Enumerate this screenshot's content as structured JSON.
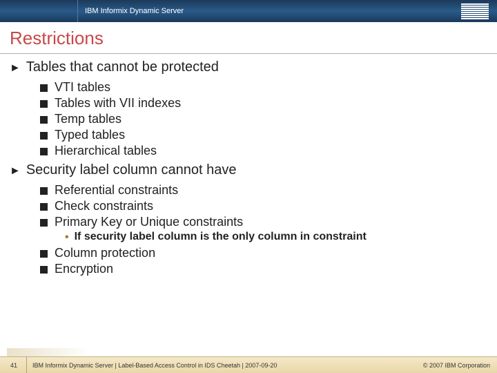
{
  "header": {
    "product": "IBM Informix Dynamic Server"
  },
  "title": "Restrictions",
  "sections": [
    {
      "heading": "Tables that cannot be protected",
      "items": [
        {
          "text": "VTI tables"
        },
        {
          "text": "Tables with VII indexes"
        },
        {
          "text": "Temp tables"
        },
        {
          "text": "Typed tables"
        },
        {
          "text": "Hierarchical tables"
        }
      ]
    },
    {
      "heading": "Security label column cannot have",
      "items": [
        {
          "text": "Referential constraints"
        },
        {
          "text": "Check constraints"
        },
        {
          "text": "Primary Key or Unique constraints",
          "sub": [
            "If security label column is the only column in constraint"
          ]
        },
        {
          "text": "Column protection"
        },
        {
          "text": "Encryption"
        }
      ]
    }
  ],
  "footer": {
    "page": "41",
    "text": "IBM Informix Dynamic Server  |  Label-Based Access Control in IDS Cheetah | 2007-09-20",
    "copyright": "© 2007 IBM Corporation"
  }
}
